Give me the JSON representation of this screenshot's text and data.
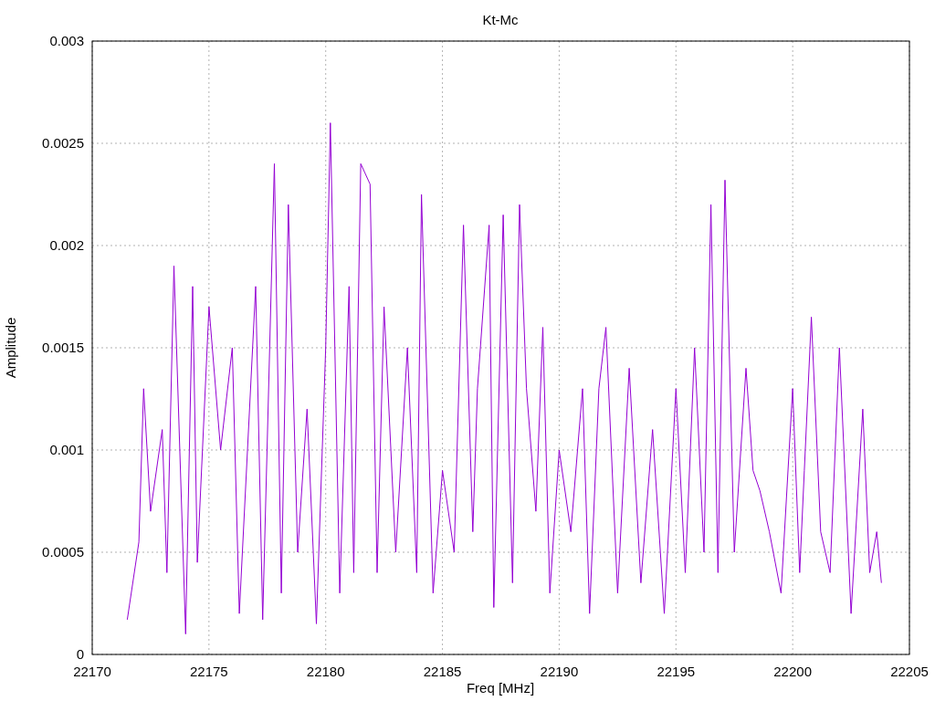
{
  "plot": {
    "chart_data": {
      "type": "line",
      "title": "Kt-Mc",
      "xlabel": "Freq [MHz]",
      "ylabel": "Amplitude",
      "grid": true,
      "xlim": [
        22170,
        22205
      ],
      "ylim": [
        0,
        0.003
      ],
      "xticks": [
        22170,
        22175,
        22180,
        22185,
        22190,
        22195,
        22200,
        22205
      ],
      "yticks": [
        {
          "value": 0,
          "label": "0"
        },
        {
          "value": 0.0005,
          "label": "0.0005"
        },
        {
          "value": 0.001,
          "label": "0.001"
        },
        {
          "value": 0.0015,
          "label": "0.0015"
        },
        {
          "value": 0.002,
          "label": "0.002"
        },
        {
          "value": 0.0025,
          "label": "0.0025"
        },
        {
          "value": 0.003,
          "label": "0.003"
        }
      ],
      "x": [
        22171.5,
        22172,
        22172.2,
        22172.5,
        22173,
        22173.2,
        22173.5,
        22174,
        22174.3,
        22174.5,
        22175,
        22175.5,
        22176,
        22176.3,
        22177,
        22177.3,
        22177.8,
        22178.1,
        22178.4,
        22178.8,
        22179.2,
        22179.6,
        22180,
        22180.2,
        22180.6,
        22181,
        22181.2,
        22181.5,
        22181.9,
        22182.2,
        22182.5,
        22183,
        22183.5,
        22183.9,
        22184.1,
        22184.6,
        22185,
        22185.5,
        22185.9,
        22186.3,
        22186.5,
        22187,
        22187.2,
        22187.6,
        22188,
        22188.3,
        22188.6,
        22189,
        22189.3,
        22189.6,
        22190,
        22190.5,
        22191,
        22191.3,
        22191.7,
        22192,
        22192.5,
        22193,
        22193.5,
        22194,
        22194.5,
        22195,
        22195.4,
        22195.8,
        22196.2,
        22196.5,
        22196.8,
        22197.1,
        22197.5,
        22198,
        22198.3,
        22198.6,
        22199,
        22199.5,
        22200,
        22200.3,
        22200.5,
        22200.8,
        22201.2,
        22201.6,
        22202,
        22202.5,
        22203,
        22203.3,
        22203.6,
        22203.8
      ],
      "series": [
        {
          "color": "#9400d3",
          "values": [
            0.00017,
            0.00055,
            0.0013,
            0.0007,
            0.0011,
            0.0004,
            0.0019,
            0.0001,
            0.0018,
            0.00045,
            0.0017,
            0.001,
            0.0015,
            0.0002,
            0.0018,
            0.00017,
            0.0024,
            0.0003,
            0.0022,
            0.0005,
            0.0012,
            0.00015,
            0.0015,
            0.0026,
            0.0003,
            0.0018,
            0.0004,
            0.0024,
            0.0023,
            0.0004,
            0.0017,
            0.0005,
            0.0015,
            0.0004,
            0.00225,
            0.0003,
            0.0009,
            0.0005,
            0.0021,
            0.0006,
            0.0013,
            0.0021,
            0.00023,
            0.00215,
            0.00035,
            0.0022,
            0.0013,
            0.0007,
            0.0016,
            0.0003,
            0.001,
            0.0006,
            0.0013,
            0.0002,
            0.0013,
            0.0016,
            0.0003,
            0.0014,
            0.00035,
            0.0011,
            0.0002,
            0.0013,
            0.0004,
            0.0015,
            0.0005,
            0.0022,
            0.0004,
            0.00232,
            0.0005,
            0.0014,
            0.0009,
            0.0008,
            0.0006,
            0.0003,
            0.0013,
            0.0004,
            0.0009,
            0.00165,
            0.0006,
            0.0004,
            0.0015,
            0.0002,
            0.0012,
            0.0004,
            0.0006,
            0.00035
          ]
        }
      ]
    }
  }
}
